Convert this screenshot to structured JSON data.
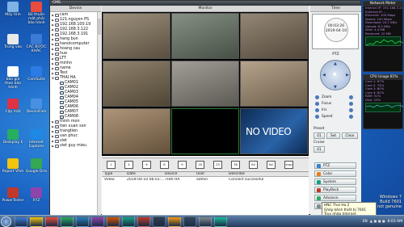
{
  "desktop": {
    "icons": [
      {
        "label": "Máy tính",
        "color": "#7fb3e6"
      },
      {
        "label": "Bỏ thuần mặt phải bảo hành",
        "color": "#e74c3c"
      },
      {
        "label": "Trung vào",
        "color": "#e8e8e8"
      },
      {
        "label": "CÁC BƯỚC KHÁC",
        "color": "#3a7bd5"
      },
      {
        "label": "bảo giá theo bảo hành",
        "color": "#ffffff"
      },
      {
        "label": "CamSuite",
        "color": "#2c7be5"
      },
      {
        "label": "Cập mật",
        "color": "#d34"
      },
      {
        "label": "DeviceFam",
        "color": "#4a90e2"
      },
      {
        "label": "Deskplay E",
        "color": "#27ae60"
      },
      {
        "label": "Internet Explorer",
        "color": "#1e88e5"
      },
      {
        "label": "Report Vĩnh",
        "color": "#f1c40f"
      },
      {
        "label": "Google Driv",
        "color": "#34a853"
      },
      {
        "label": "PowerTester",
        "color": "#c0392b"
      },
      {
        "label": "XYZ",
        "color": "#8e44ad"
      }
    ]
  },
  "window": {
    "title": "CMS",
    "device_header": "Device",
    "monitor_header": "Monitor",
    "time_header": "Time"
  },
  "devices": [
    {
      "label": "cam",
      "indent": 0,
      "kind": "dev"
    },
    {
      "label": "121.nguyen PS",
      "indent": 0,
      "kind": "dev"
    },
    {
      "label": "192.168.100.19",
      "indent": 0,
      "kind": "dev"
    },
    {
      "label": "192.168.3.122",
      "indent": 0,
      "kind": "dev"
    },
    {
      "label": "192.168.3.191",
      "indent": 0,
      "kind": "dev"
    },
    {
      "label": "hang bun",
      "indent": 0,
      "kind": "dev"
    },
    {
      "label": "hanoicomputer",
      "indent": 0,
      "kind": "dev"
    },
    {
      "label": "hoang cau",
      "indent": 0,
      "kind": "dev"
    },
    {
      "label": "hue",
      "indent": 0,
      "kind": "dev"
    },
    {
      "label": "LTT",
      "indent": 0,
      "kind": "dev"
    },
    {
      "label": "minhn",
      "indent": 0,
      "kind": "dev"
    },
    {
      "label": "name",
      "indent": 0,
      "kind": "dev"
    },
    {
      "label": "Test",
      "indent": 0,
      "kind": "dev"
    },
    {
      "label": "THAI HA",
      "indent": 0,
      "kind": "dev",
      "expanded": true
    },
    {
      "label": "CAM01",
      "indent": 1,
      "kind": "cam"
    },
    {
      "label": "CAM02",
      "indent": 1,
      "kind": "cam"
    },
    {
      "label": "CAM03",
      "indent": 1,
      "kind": "cam"
    },
    {
      "label": "CAM04",
      "indent": 1,
      "kind": "cam"
    },
    {
      "label": "CAM05",
      "indent": 1,
      "kind": "cam"
    },
    {
      "label": "CAM06",
      "indent": 1,
      "kind": "cam"
    },
    {
      "label": "CAM07",
      "indent": 1,
      "kind": "cam"
    },
    {
      "label": "CAM08",
      "indent": 1,
      "kind": "cam"
    },
    {
      "label": "thinh mon",
      "indent": 0,
      "kind": "dev"
    },
    {
      "label": "tien xuan son",
      "indent": 0,
      "kind": "dev"
    },
    {
      "label": "trangtien",
      "indent": 0,
      "kind": "dev"
    },
    {
      "label": "van phuc",
      "indent": 0,
      "kind": "dev"
    },
    {
      "label": "viet",
      "indent": 0,
      "kind": "dev"
    },
    {
      "label": "viet guy mieu",
      "indent": 0,
      "kind": "dev"
    }
  ],
  "monitor": {
    "cells": [
      {
        "name": "cam-view-1",
        "bg": "#8a7a62",
        "selected": false
      },
      {
        "name": "cam-view-2",
        "bg": "#6c7a6a",
        "selected": false
      },
      {
        "name": "cam-view-3",
        "bg": "#7d6d58",
        "selected": false
      },
      {
        "name": "cam-view-4",
        "bg": "#7a6a50",
        "selected": false
      },
      {
        "name": "cam-view-5",
        "bg": "#8d8a80",
        "selected": false
      },
      {
        "name": "cam-view-6",
        "bg": "#a58f72",
        "selected": false
      },
      {
        "name": "cam-view-7",
        "bg": "#9b7e5c",
        "selected": false
      },
      {
        "name": "cam-view-8",
        "bg": "#000000",
        "selected": true
      },
      {
        "name": "cam-view-9",
        "bg": "#1d4f8a",
        "selected": false
      }
    ],
    "no_video_text": "NO VIDEO"
  },
  "layout_buttons": [
    "1",
    "4",
    "6",
    "8",
    "9",
    "16",
    "25",
    "36",
    "64",
    "full",
    "stop"
  ],
  "log": {
    "headers": [
      "Type",
      "Date",
      "Device",
      "User",
      "Describe"
    ],
    "rows": [
      [
        "Video",
        "2019-04-10 06:01:...",
        "THAI HA",
        "admin",
        "Connect successful"
      ]
    ]
  },
  "time_panel": {
    "time": "00:03:26",
    "date": "2019-04-10"
  },
  "ptz": {
    "label": "PTZ",
    "controls": [
      "Zoom",
      "Focus",
      "Iris",
      "Speed"
    ],
    "preset_label": "Preset",
    "preset_value": "01",
    "cruise_label": "Cruise",
    "cruise_value": "01",
    "set_label": "Set",
    "clear_label": "Clear"
  },
  "side_buttons": [
    {
      "label": "PTZ",
      "color": "#3b82c4"
    },
    {
      "label": "Color",
      "color": "#e67e22"
    },
    {
      "label": "System",
      "color": "#16a085"
    },
    {
      "label": "PlayBack",
      "color": "#c0392b"
    },
    {
      "label": "Advance",
      "color": "#27ae60"
    },
    {
      "label": "LogOut",
      "color": "#7f8c8d"
    }
  ],
  "gadgets": {
    "network": {
      "title": "Network Meter",
      "lines": [
        "Internal IP: 192.168.3.20",
        "External IP: ...",
        "Ethernet: 100 Mbps",
        "Speed: 100 Mbps",
        "Download: 16.1 KB/s",
        "Upload: 6.2 KB/s",
        "Sent: 4.4 MB",
        "Received: 10 MB"
      ]
    },
    "cpu": {
      "title": "CPU Usage",
      "value": "81%",
      "lines": [
        "Core 1: 87%",
        "Core 2: 75%",
        "Core 3: 80%",
        "Core 4: 82%",
        "RAM: 51%",
        "Disk: 23%"
      ]
    }
  },
  "watermark": {
    "line1": "Windows 7",
    "line2": "Build 7601",
    "line3": "This copy of Windows is not genuine"
  },
  "tooltip": {
    "line1": "HNC Thai Ha 2",
    "line2": "Ghép kênh thiết bị 7601",
    "line3": "Truy nhập Internet"
  },
  "taskbar": {
    "items": [
      "#3a7bd5",
      "#f1c40f",
      "#e74c3c",
      "#27ae60",
      "#2980b9",
      "#8e44ad",
      "#d35400",
      "#16a085",
      "#c0392b",
      "#2c3e50",
      "#f39c12",
      "#34495e",
      "#7f8c8d",
      "#1abc9c"
    ],
    "language": "EN",
    "time": "8:03 AM"
  }
}
